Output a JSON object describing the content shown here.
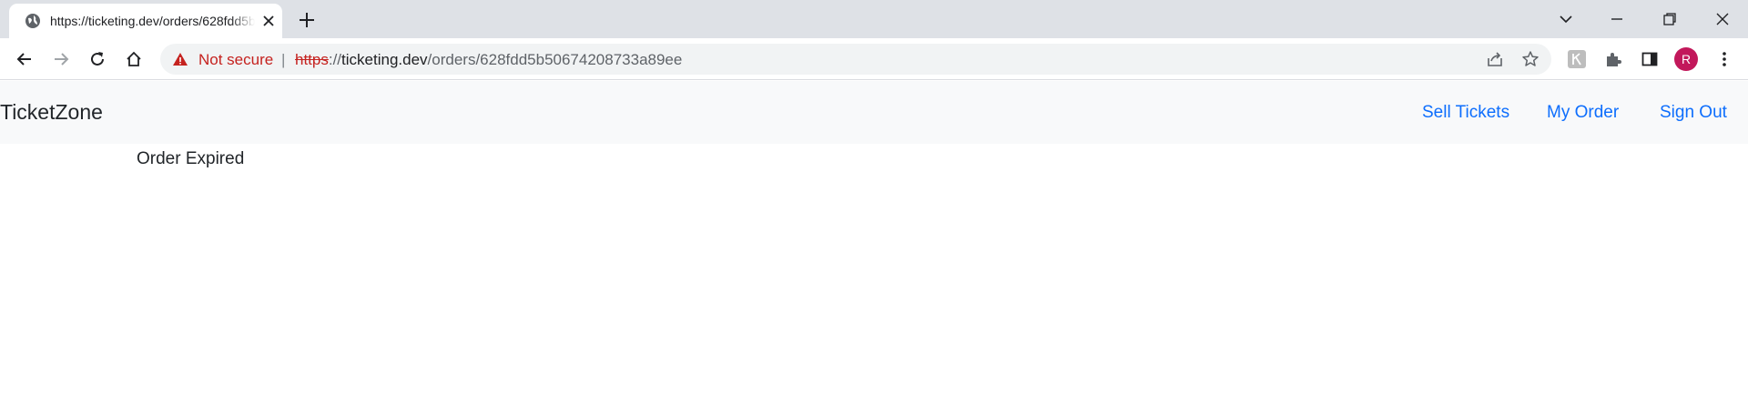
{
  "browser": {
    "tab": {
      "title": "https://ticketing.dev/orders/628fdd5b50674208733a89ee",
      "favicon": "globe-icon"
    },
    "address_bar": {
      "security_label": "Not secure",
      "separator": "|",
      "url_scheme": "https",
      "url_scheme_sep": "://",
      "url_host": "ticketing.dev",
      "url_path": "/orders/628fdd5b50674208733a89ee"
    },
    "profile_initial": "R",
    "colors": {
      "warning": "#c5221f",
      "avatar": "#c2185b",
      "link": "#0d6efd"
    }
  },
  "navbar": {
    "brand": "TicketZone",
    "links": [
      {
        "label": "Sell Tickets"
      },
      {
        "label": "My Order"
      },
      {
        "label": "Sign Out"
      }
    ]
  },
  "content": {
    "message": "Order Expired"
  }
}
